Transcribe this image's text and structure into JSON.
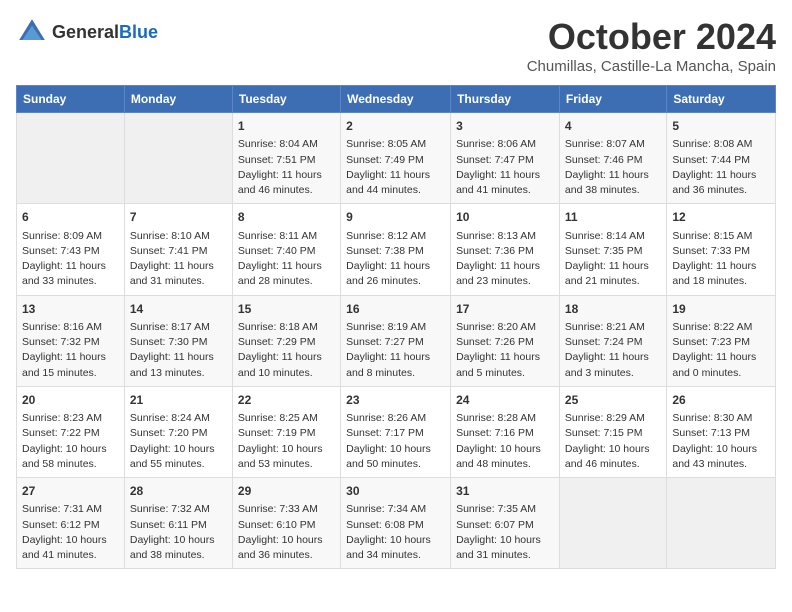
{
  "header": {
    "logo_general": "General",
    "logo_blue": "Blue",
    "month": "October 2024",
    "location": "Chumillas, Castille-La Mancha, Spain"
  },
  "weekdays": [
    "Sunday",
    "Monday",
    "Tuesday",
    "Wednesday",
    "Thursday",
    "Friday",
    "Saturday"
  ],
  "weeks": [
    [
      {
        "day": "",
        "empty": true
      },
      {
        "day": "",
        "empty": true
      },
      {
        "day": "1",
        "sunrise": "Sunrise: 8:04 AM",
        "sunset": "Sunset: 7:51 PM",
        "daylight": "Daylight: 11 hours and 46 minutes."
      },
      {
        "day": "2",
        "sunrise": "Sunrise: 8:05 AM",
        "sunset": "Sunset: 7:49 PM",
        "daylight": "Daylight: 11 hours and 44 minutes."
      },
      {
        "day": "3",
        "sunrise": "Sunrise: 8:06 AM",
        "sunset": "Sunset: 7:47 PM",
        "daylight": "Daylight: 11 hours and 41 minutes."
      },
      {
        "day": "4",
        "sunrise": "Sunrise: 8:07 AM",
        "sunset": "Sunset: 7:46 PM",
        "daylight": "Daylight: 11 hours and 38 minutes."
      },
      {
        "day": "5",
        "sunrise": "Sunrise: 8:08 AM",
        "sunset": "Sunset: 7:44 PM",
        "daylight": "Daylight: 11 hours and 36 minutes."
      }
    ],
    [
      {
        "day": "6",
        "sunrise": "Sunrise: 8:09 AM",
        "sunset": "Sunset: 7:43 PM",
        "daylight": "Daylight: 11 hours and 33 minutes."
      },
      {
        "day": "7",
        "sunrise": "Sunrise: 8:10 AM",
        "sunset": "Sunset: 7:41 PM",
        "daylight": "Daylight: 11 hours and 31 minutes."
      },
      {
        "day": "8",
        "sunrise": "Sunrise: 8:11 AM",
        "sunset": "Sunset: 7:40 PM",
        "daylight": "Daylight: 11 hours and 28 minutes."
      },
      {
        "day": "9",
        "sunrise": "Sunrise: 8:12 AM",
        "sunset": "Sunset: 7:38 PM",
        "daylight": "Daylight: 11 hours and 26 minutes."
      },
      {
        "day": "10",
        "sunrise": "Sunrise: 8:13 AM",
        "sunset": "Sunset: 7:36 PM",
        "daylight": "Daylight: 11 hours and 23 minutes."
      },
      {
        "day": "11",
        "sunrise": "Sunrise: 8:14 AM",
        "sunset": "Sunset: 7:35 PM",
        "daylight": "Daylight: 11 hours and 21 minutes."
      },
      {
        "day": "12",
        "sunrise": "Sunrise: 8:15 AM",
        "sunset": "Sunset: 7:33 PM",
        "daylight": "Daylight: 11 hours and 18 minutes."
      }
    ],
    [
      {
        "day": "13",
        "sunrise": "Sunrise: 8:16 AM",
        "sunset": "Sunset: 7:32 PM",
        "daylight": "Daylight: 11 hours and 15 minutes."
      },
      {
        "day": "14",
        "sunrise": "Sunrise: 8:17 AM",
        "sunset": "Sunset: 7:30 PM",
        "daylight": "Daylight: 11 hours and 13 minutes."
      },
      {
        "day": "15",
        "sunrise": "Sunrise: 8:18 AM",
        "sunset": "Sunset: 7:29 PM",
        "daylight": "Daylight: 11 hours and 10 minutes."
      },
      {
        "day": "16",
        "sunrise": "Sunrise: 8:19 AM",
        "sunset": "Sunset: 7:27 PM",
        "daylight": "Daylight: 11 hours and 8 minutes."
      },
      {
        "day": "17",
        "sunrise": "Sunrise: 8:20 AM",
        "sunset": "Sunset: 7:26 PM",
        "daylight": "Daylight: 11 hours and 5 minutes."
      },
      {
        "day": "18",
        "sunrise": "Sunrise: 8:21 AM",
        "sunset": "Sunset: 7:24 PM",
        "daylight": "Daylight: 11 hours and 3 minutes."
      },
      {
        "day": "19",
        "sunrise": "Sunrise: 8:22 AM",
        "sunset": "Sunset: 7:23 PM",
        "daylight": "Daylight: 11 hours and 0 minutes."
      }
    ],
    [
      {
        "day": "20",
        "sunrise": "Sunrise: 8:23 AM",
        "sunset": "Sunset: 7:22 PM",
        "daylight": "Daylight: 10 hours and 58 minutes."
      },
      {
        "day": "21",
        "sunrise": "Sunrise: 8:24 AM",
        "sunset": "Sunset: 7:20 PM",
        "daylight": "Daylight: 10 hours and 55 minutes."
      },
      {
        "day": "22",
        "sunrise": "Sunrise: 8:25 AM",
        "sunset": "Sunset: 7:19 PM",
        "daylight": "Daylight: 10 hours and 53 minutes."
      },
      {
        "day": "23",
        "sunrise": "Sunrise: 8:26 AM",
        "sunset": "Sunset: 7:17 PM",
        "daylight": "Daylight: 10 hours and 50 minutes."
      },
      {
        "day": "24",
        "sunrise": "Sunrise: 8:28 AM",
        "sunset": "Sunset: 7:16 PM",
        "daylight": "Daylight: 10 hours and 48 minutes."
      },
      {
        "day": "25",
        "sunrise": "Sunrise: 8:29 AM",
        "sunset": "Sunset: 7:15 PM",
        "daylight": "Daylight: 10 hours and 46 minutes."
      },
      {
        "day": "26",
        "sunrise": "Sunrise: 8:30 AM",
        "sunset": "Sunset: 7:13 PM",
        "daylight": "Daylight: 10 hours and 43 minutes."
      }
    ],
    [
      {
        "day": "27",
        "sunrise": "Sunrise: 7:31 AM",
        "sunset": "Sunset: 6:12 PM",
        "daylight": "Daylight: 10 hours and 41 minutes."
      },
      {
        "day": "28",
        "sunrise": "Sunrise: 7:32 AM",
        "sunset": "Sunset: 6:11 PM",
        "daylight": "Daylight: 10 hours and 38 minutes."
      },
      {
        "day": "29",
        "sunrise": "Sunrise: 7:33 AM",
        "sunset": "Sunset: 6:10 PM",
        "daylight": "Daylight: 10 hours and 36 minutes."
      },
      {
        "day": "30",
        "sunrise": "Sunrise: 7:34 AM",
        "sunset": "Sunset: 6:08 PM",
        "daylight": "Daylight: 10 hours and 34 minutes."
      },
      {
        "day": "31",
        "sunrise": "Sunrise: 7:35 AM",
        "sunset": "Sunset: 6:07 PM",
        "daylight": "Daylight: 10 hours and 31 minutes."
      },
      {
        "day": "",
        "empty": true
      },
      {
        "day": "",
        "empty": true
      }
    ]
  ]
}
